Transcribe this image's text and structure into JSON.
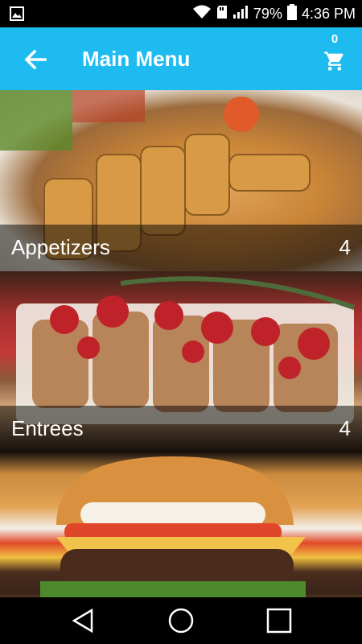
{
  "status_bar": {
    "battery": "79%",
    "time": "4:36 PM"
  },
  "app_bar": {
    "title": "Main Menu",
    "cart_count": "0"
  },
  "categories": [
    {
      "name": "Appetizers",
      "count": "4"
    },
    {
      "name": "Entrees",
      "count": "4"
    },
    {
      "name": "",
      "count": ""
    }
  ],
  "colors": {
    "app_bar": "#1EBBF0",
    "status_bar": "#000000",
    "nav_bar": "#000000",
    "text": "#FFFFFF"
  },
  "icons": {
    "back": "arrow-left-icon",
    "cart": "shopping-cart-icon",
    "nav_back": "triangle-back-icon",
    "nav_home": "circle-home-icon",
    "nav_recents": "square-recents-icon"
  }
}
